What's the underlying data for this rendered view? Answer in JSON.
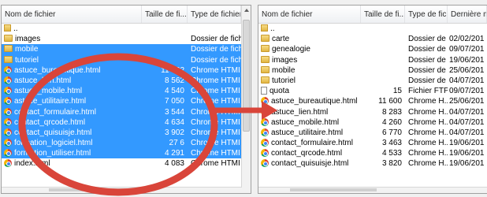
{
  "left_pane": {
    "columns": [
      "Nom de fichier",
      "Taille de fi...",
      "Type de fichier"
    ],
    "rows": [
      {
        "name": "..",
        "size": "",
        "type": "",
        "icon": "up-folder-icon",
        "selected": false
      },
      {
        "name": "images",
        "size": "",
        "type": "Dossier de fich",
        "icon": "folder-icon",
        "selected": false
      },
      {
        "name": "mobile",
        "size": "",
        "type": "Dossier de fich",
        "icon": "folder-icon",
        "selected": true
      },
      {
        "name": "tutoriel",
        "size": "",
        "type": "Dossier de fich",
        "icon": "folder-icon",
        "selected": true
      },
      {
        "name": "astuce_bureautique.html",
        "size": "11 882",
        "type": "Chrome HTMI",
        "icon": "chrome-icon",
        "selected": true
      },
      {
        "name": "astuce_lien.html",
        "size": "8 562",
        "type": "Chrome HTMI",
        "icon": "chrome-icon",
        "selected": true
      },
      {
        "name": "astuce_mobile.html",
        "size": "4 540",
        "type": "Chrome HTMI",
        "icon": "chrome-icon",
        "selected": true
      },
      {
        "name": "astuce_utilitaire.html",
        "size": "7 050",
        "type": "Chrome HTMI",
        "icon": "chrome-icon",
        "selected": true
      },
      {
        "name": "contact_formulaire.html",
        "size": "3 544",
        "type": "Chrome HTMI",
        "icon": "chrome-icon",
        "selected": true
      },
      {
        "name": "contact_qrcode.html",
        "size": "4 634",
        "type": "Chrome HTMI",
        "icon": "chrome-icon",
        "selected": true
      },
      {
        "name": "contact_quisuisje.html",
        "size": "3 902",
        "type": "Chrome HTMI",
        "icon": "chrome-icon",
        "selected": true
      },
      {
        "name": "formation_logiciel.html",
        "size": "27 6",
        "type": "Chrome HTMI",
        "icon": "chrome-icon",
        "selected": true
      },
      {
        "name": "formation_utiliser.html",
        "size": "4 291",
        "type": "Chrome HTMI",
        "icon": "chrome-icon",
        "selected": true
      },
      {
        "name": "index.html",
        "size": "4 083",
        "type": "Chrome HTMI",
        "icon": "chrome-icon",
        "selected": false
      }
    ]
  },
  "right_pane": {
    "columns": [
      "Nom de fichier",
      "Taille de fi...",
      "Type de fic...",
      "Dernière m"
    ],
    "rows": [
      {
        "name": "..",
        "size": "",
        "type": "",
        "date": "",
        "icon": "up-folder-icon"
      },
      {
        "name": "carte",
        "size": "",
        "type": "Dossier de ...",
        "date": "02/02/201",
        "icon": "folder-icon"
      },
      {
        "name": "genealogie",
        "size": "",
        "type": "Dossier de ...",
        "date": "09/07/201",
        "icon": "folder-icon"
      },
      {
        "name": "images",
        "size": "",
        "type": "Dossier de ...",
        "date": "19/06/201",
        "icon": "folder-icon"
      },
      {
        "name": "mobile",
        "size": "",
        "type": "Dossier de ...",
        "date": "25/06/201",
        "icon": "folder-icon"
      },
      {
        "name": "tutoriel",
        "size": "",
        "type": "Dossier de ...",
        "date": "04/07/201",
        "icon": "folder-icon"
      },
      {
        "name": "quota",
        "size": "15",
        "type": "Fichier FTP...",
        "date": "09/07/201",
        "icon": "file-icon"
      },
      {
        "name": "astuce_bureautique.html",
        "size": "11 600",
        "type": "Chrome H...",
        "date": "25/06/201",
        "icon": "chrome-icon"
      },
      {
        "name": "astuce_lien.html",
        "size": "8 283",
        "type": "Chrome H...",
        "date": "04/07/201",
        "icon": "chrome-icon"
      },
      {
        "name": "astuce_mobile.html",
        "size": "4 260",
        "type": "Chrome H...",
        "date": "04/07/201",
        "icon": "chrome-icon"
      },
      {
        "name": "astuce_utilitaire.html",
        "size": "6 770",
        "type": "Chrome H...",
        "date": "04/07/201",
        "icon": "chrome-icon"
      },
      {
        "name": "contact_formulaire.html",
        "size": "3 463",
        "type": "Chrome H...",
        "date": "19/06/201",
        "icon": "chrome-icon"
      },
      {
        "name": "contact_qrcode.html",
        "size": "4 533",
        "type": "Chrome H...",
        "date": "19/06/201",
        "icon": "chrome-icon"
      },
      {
        "name": "contact_quisuisje.html",
        "size": "3 820",
        "type": "Chrome H...",
        "date": "19/06/201",
        "icon": "chrome-icon"
      }
    ]
  },
  "colors": {
    "selection": "#3399ff",
    "annotation_red": "#d9453a"
  }
}
